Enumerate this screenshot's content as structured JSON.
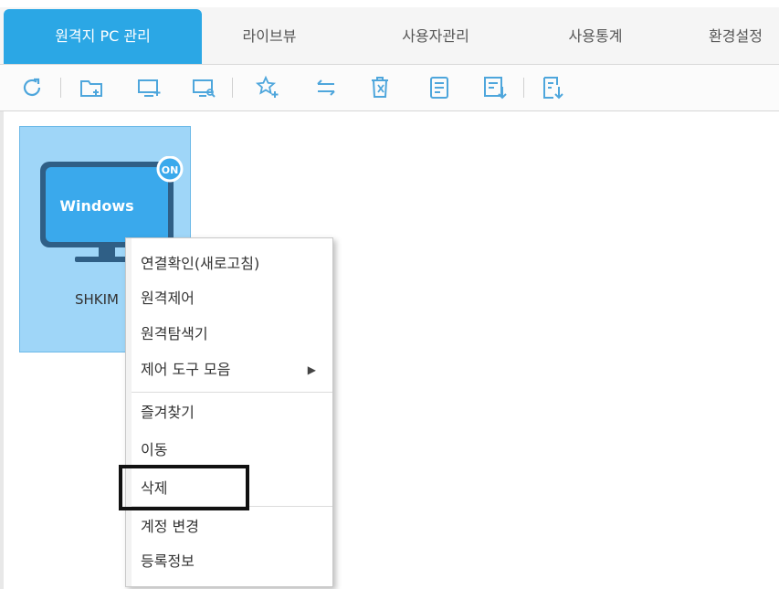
{
  "tabs": [
    {
      "label": "원격지 PC 관리",
      "active": true
    },
    {
      "label": "라이브뷰",
      "active": false
    },
    {
      "label": "사용자관리",
      "active": false
    },
    {
      "label": "사용통계",
      "active": false
    },
    {
      "label": "환경설정",
      "active": false
    }
  ],
  "toolbar_icons": [
    "refresh-icon",
    "add-folder-icon",
    "add-pc-icon",
    "search-pc-icon",
    "add-favorite-icon",
    "move-icon",
    "delete-icon",
    "list-icon",
    "export-icon",
    "import-icon"
  ],
  "pc": {
    "os_label": "Windows",
    "status": "ON",
    "name": "SHKIM"
  },
  "context_menu": {
    "items": [
      {
        "label": "연결확인(새로고침)"
      },
      {
        "label": "원격제어"
      },
      {
        "label": "원격탐색기"
      },
      {
        "label": "제어 도구 모음",
        "submenu_arrow": "▶"
      },
      {
        "label": "즐겨찾기"
      },
      {
        "label": "이동"
      },
      {
        "label": "삭제"
      },
      {
        "label": "계정 변경"
      },
      {
        "label": "등록정보"
      }
    ]
  },
  "colors": {
    "accent": "#2ba7e5",
    "card_bg": "#9fd6f8",
    "monitor": "#3aa9ec",
    "monitor_frame": "#2f5f86",
    "icon": "#4ea6dc"
  }
}
